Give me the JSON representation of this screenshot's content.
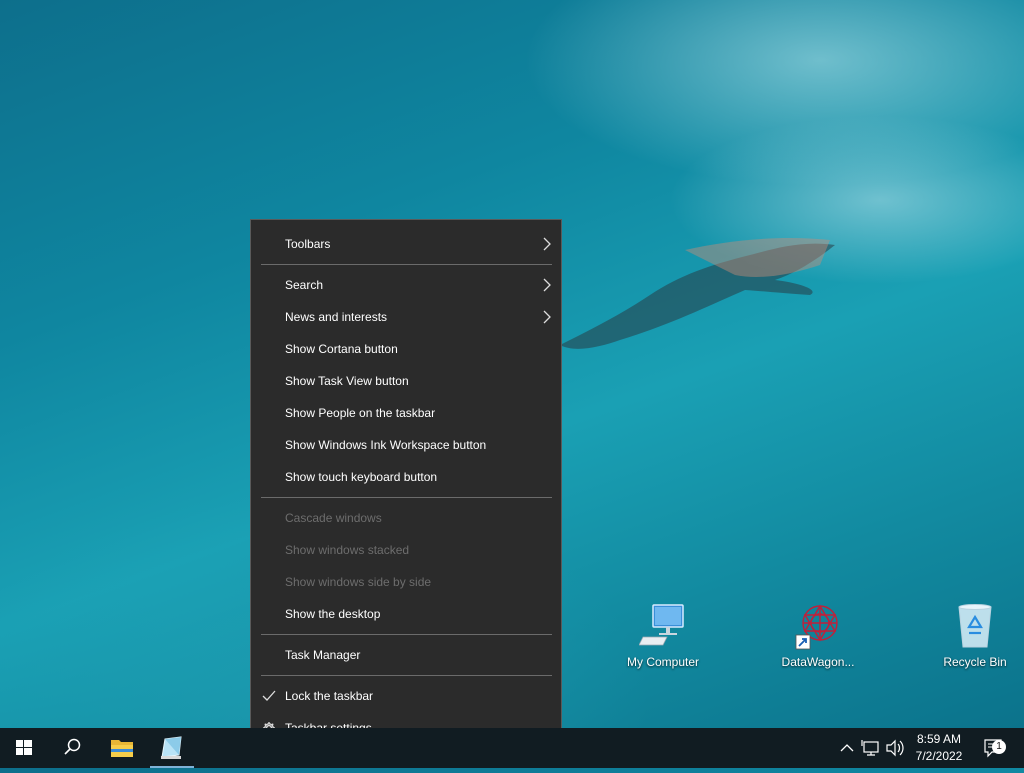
{
  "context_menu": {
    "toolbars": "Toolbars",
    "search": "Search",
    "news": "News and interests",
    "cortana": "Show Cortana button",
    "task_view": "Show Task View button",
    "people": "Show People on the taskbar",
    "ink": "Show Windows Ink Workspace button",
    "touch_keyboard": "Show touch keyboard button",
    "cascade": "Cascade windows",
    "stacked": "Show windows stacked",
    "side_by_side": "Show windows side by side",
    "show_desktop": "Show the desktop",
    "task_manager": "Task Manager",
    "lock_taskbar": "Lock the taskbar",
    "taskbar_settings": "Taskbar settings"
  },
  "desktop_icons": {
    "my_computer": "My Computer",
    "datawagon": "DataWagon...",
    "recycle_bin": "Recycle Bin"
  },
  "taskbar": {
    "time": "8:59 AM",
    "date": "7/2/2022",
    "notification_count": "1"
  },
  "colors": {
    "menu_bg": "#2b2b2b",
    "taskbar_bg": "#111c22",
    "disabled_text": "#6d6d6d"
  }
}
